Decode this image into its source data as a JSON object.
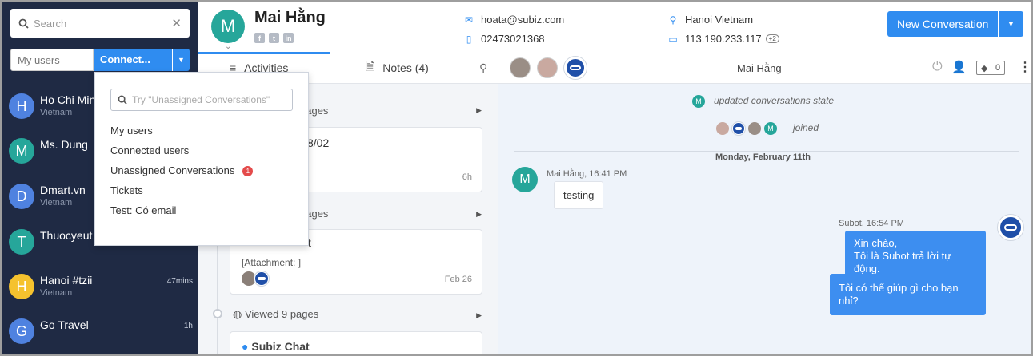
{
  "sidebar": {
    "search_placeholder": "Search",
    "filter_value": "My users",
    "connect_label": "Connect...",
    "conversations": [
      {
        "initial": "H",
        "name": "Ho Chi Min",
        "sub": "Vietnam",
        "time": "",
        "color": "#4f82e0"
      },
      {
        "initial": "M",
        "name": "Ms. Dung",
        "sub": "",
        "time": "",
        "color": "#26a69a"
      },
      {
        "initial": "D",
        "name": "Dmart.vn",
        "sub": "Vietnam",
        "time": "",
        "color": "#4f82e0"
      },
      {
        "initial": "T",
        "name": "Thuocyeut",
        "sub": "",
        "time": "",
        "color": "#26a69a"
      },
      {
        "initial": "H",
        "name": "Hanoi #tzii",
        "sub": "Vietnam",
        "time": "47mins",
        "color": "#f5c22e"
      },
      {
        "initial": "G",
        "name": "Go Travel",
        "sub": "",
        "time": "1h",
        "color": "#4f82e0"
      }
    ]
  },
  "dropdown": {
    "search_placeholder": "Try \"Unassigned Conversations\"",
    "items": [
      "My users",
      "Connected users",
      "Unassigned Conversations",
      "Tickets",
      "Test: Có email"
    ],
    "unassigned_badge": "1"
  },
  "header": {
    "initial": "M",
    "name": "Mai Hằng",
    "email": "hoata@subiz.com",
    "phone": "02473021368",
    "location": "Hanoi Vietnam",
    "ip": "113.190.233.117",
    "ip_more": "+2",
    "new_conversation_label": "New Conversation"
  },
  "tabs": {
    "activities": "Activities",
    "notes": "Notes (4)"
  },
  "timeline": {
    "row1": "pages",
    "card1_title": "8/02",
    "card1_time": "6h",
    "row2": "pages",
    "card2_title": "t",
    "card2_attachment": "[Attachment: ]",
    "card2_time": "Feb 26",
    "row3": "Viewed 9 pages",
    "card3_title": "Subiz Chat"
  },
  "chat": {
    "head_name": "Mai Hằng",
    "tag_count": "0",
    "sys1_avatar": "M",
    "sys1": "updated conversations state",
    "sys2_avatar": "M",
    "sys2": "joined",
    "date": "Monday, February 11th",
    "msg1_avatar": "M",
    "msg1_meta": "Mai Hằng, 16:41 PM",
    "msg1_text": "testing",
    "msg2_meta": "Subot, 16:54 PM",
    "msg2_line1": "Xin chào,",
    "msg2_line2": "Tôi là Subot trả lời tự động.",
    "msg3_text": "Tôi có thể giúp gì cho bạn nhỉ?"
  },
  "colors": {
    "accent": "#2f8cf0",
    "sidebar": "#1f2a44",
    "teal": "#26a69a"
  }
}
